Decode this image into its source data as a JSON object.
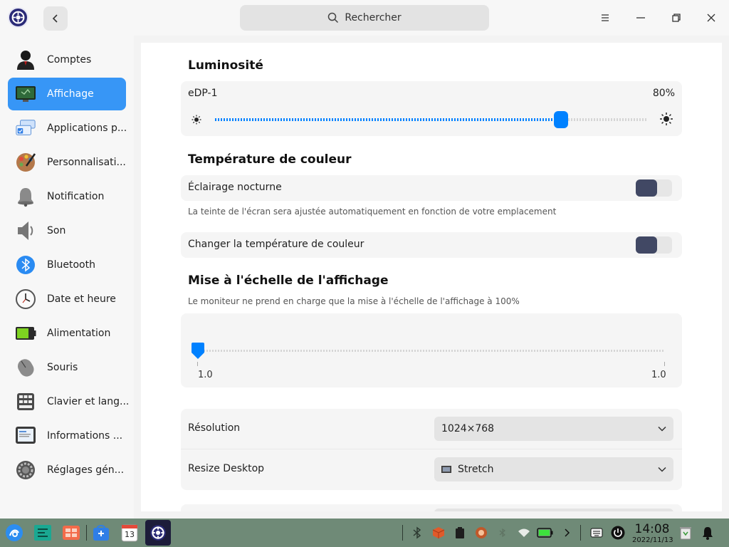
{
  "header": {
    "search_placeholder": "Rechercher"
  },
  "sidebar": {
    "items": [
      {
        "label": "Comptes",
        "icon": "user-icon"
      },
      {
        "label": "Affichage",
        "icon": "display-icon",
        "active": true
      },
      {
        "label": "Applications p...",
        "icon": "default-apps-icon"
      },
      {
        "label": "Personnalisati...",
        "icon": "palette-icon"
      },
      {
        "label": "Notification",
        "icon": "bell-icon"
      },
      {
        "label": "Son",
        "icon": "speaker-icon"
      },
      {
        "label": "Bluetooth",
        "icon": "bluetooth-icon"
      },
      {
        "label": "Date et heure",
        "icon": "clock-icon"
      },
      {
        "label": "Alimentation",
        "icon": "battery-icon"
      },
      {
        "label": "Souris",
        "icon": "mouse-icon"
      },
      {
        "label": "Clavier et lang...",
        "icon": "keyboard-icon"
      },
      {
        "label": "Informations ...",
        "icon": "system-info-icon"
      },
      {
        "label": "Réglages gén...",
        "icon": "general-settings-icon"
      }
    ]
  },
  "brightness": {
    "title": "Luminosité",
    "monitor": "eDP-1",
    "value_text": "80%",
    "value": 0.8
  },
  "color_temperature": {
    "title": "Température de couleur",
    "night_light_label": "Éclairage nocturne",
    "night_light_hint": "La teinte de l'écran sera ajustée automatiquement en fonction de votre emplacement",
    "change_temp_label": "Changer la température de couleur"
  },
  "scaling": {
    "title": "Mise à l'échelle de l'affichage",
    "hint": "Le moniteur ne prend en charge que la mise à l'échelle de l'affichage à 100%",
    "min_label": "1.0",
    "max_label": "1.0"
  },
  "resolution": {
    "label": "Résolution",
    "value": "1024×768"
  },
  "resize": {
    "label": "Resize Desktop",
    "value": "Stretch"
  },
  "taskbar": {
    "time": "14:08",
    "date": "2022/11/13",
    "calendar_day": "13"
  },
  "colors": {
    "accent": "#3796f6",
    "slider_accent": "#0081ff",
    "toggle_off": "#414864",
    "taskbar": "#6f8a77"
  }
}
